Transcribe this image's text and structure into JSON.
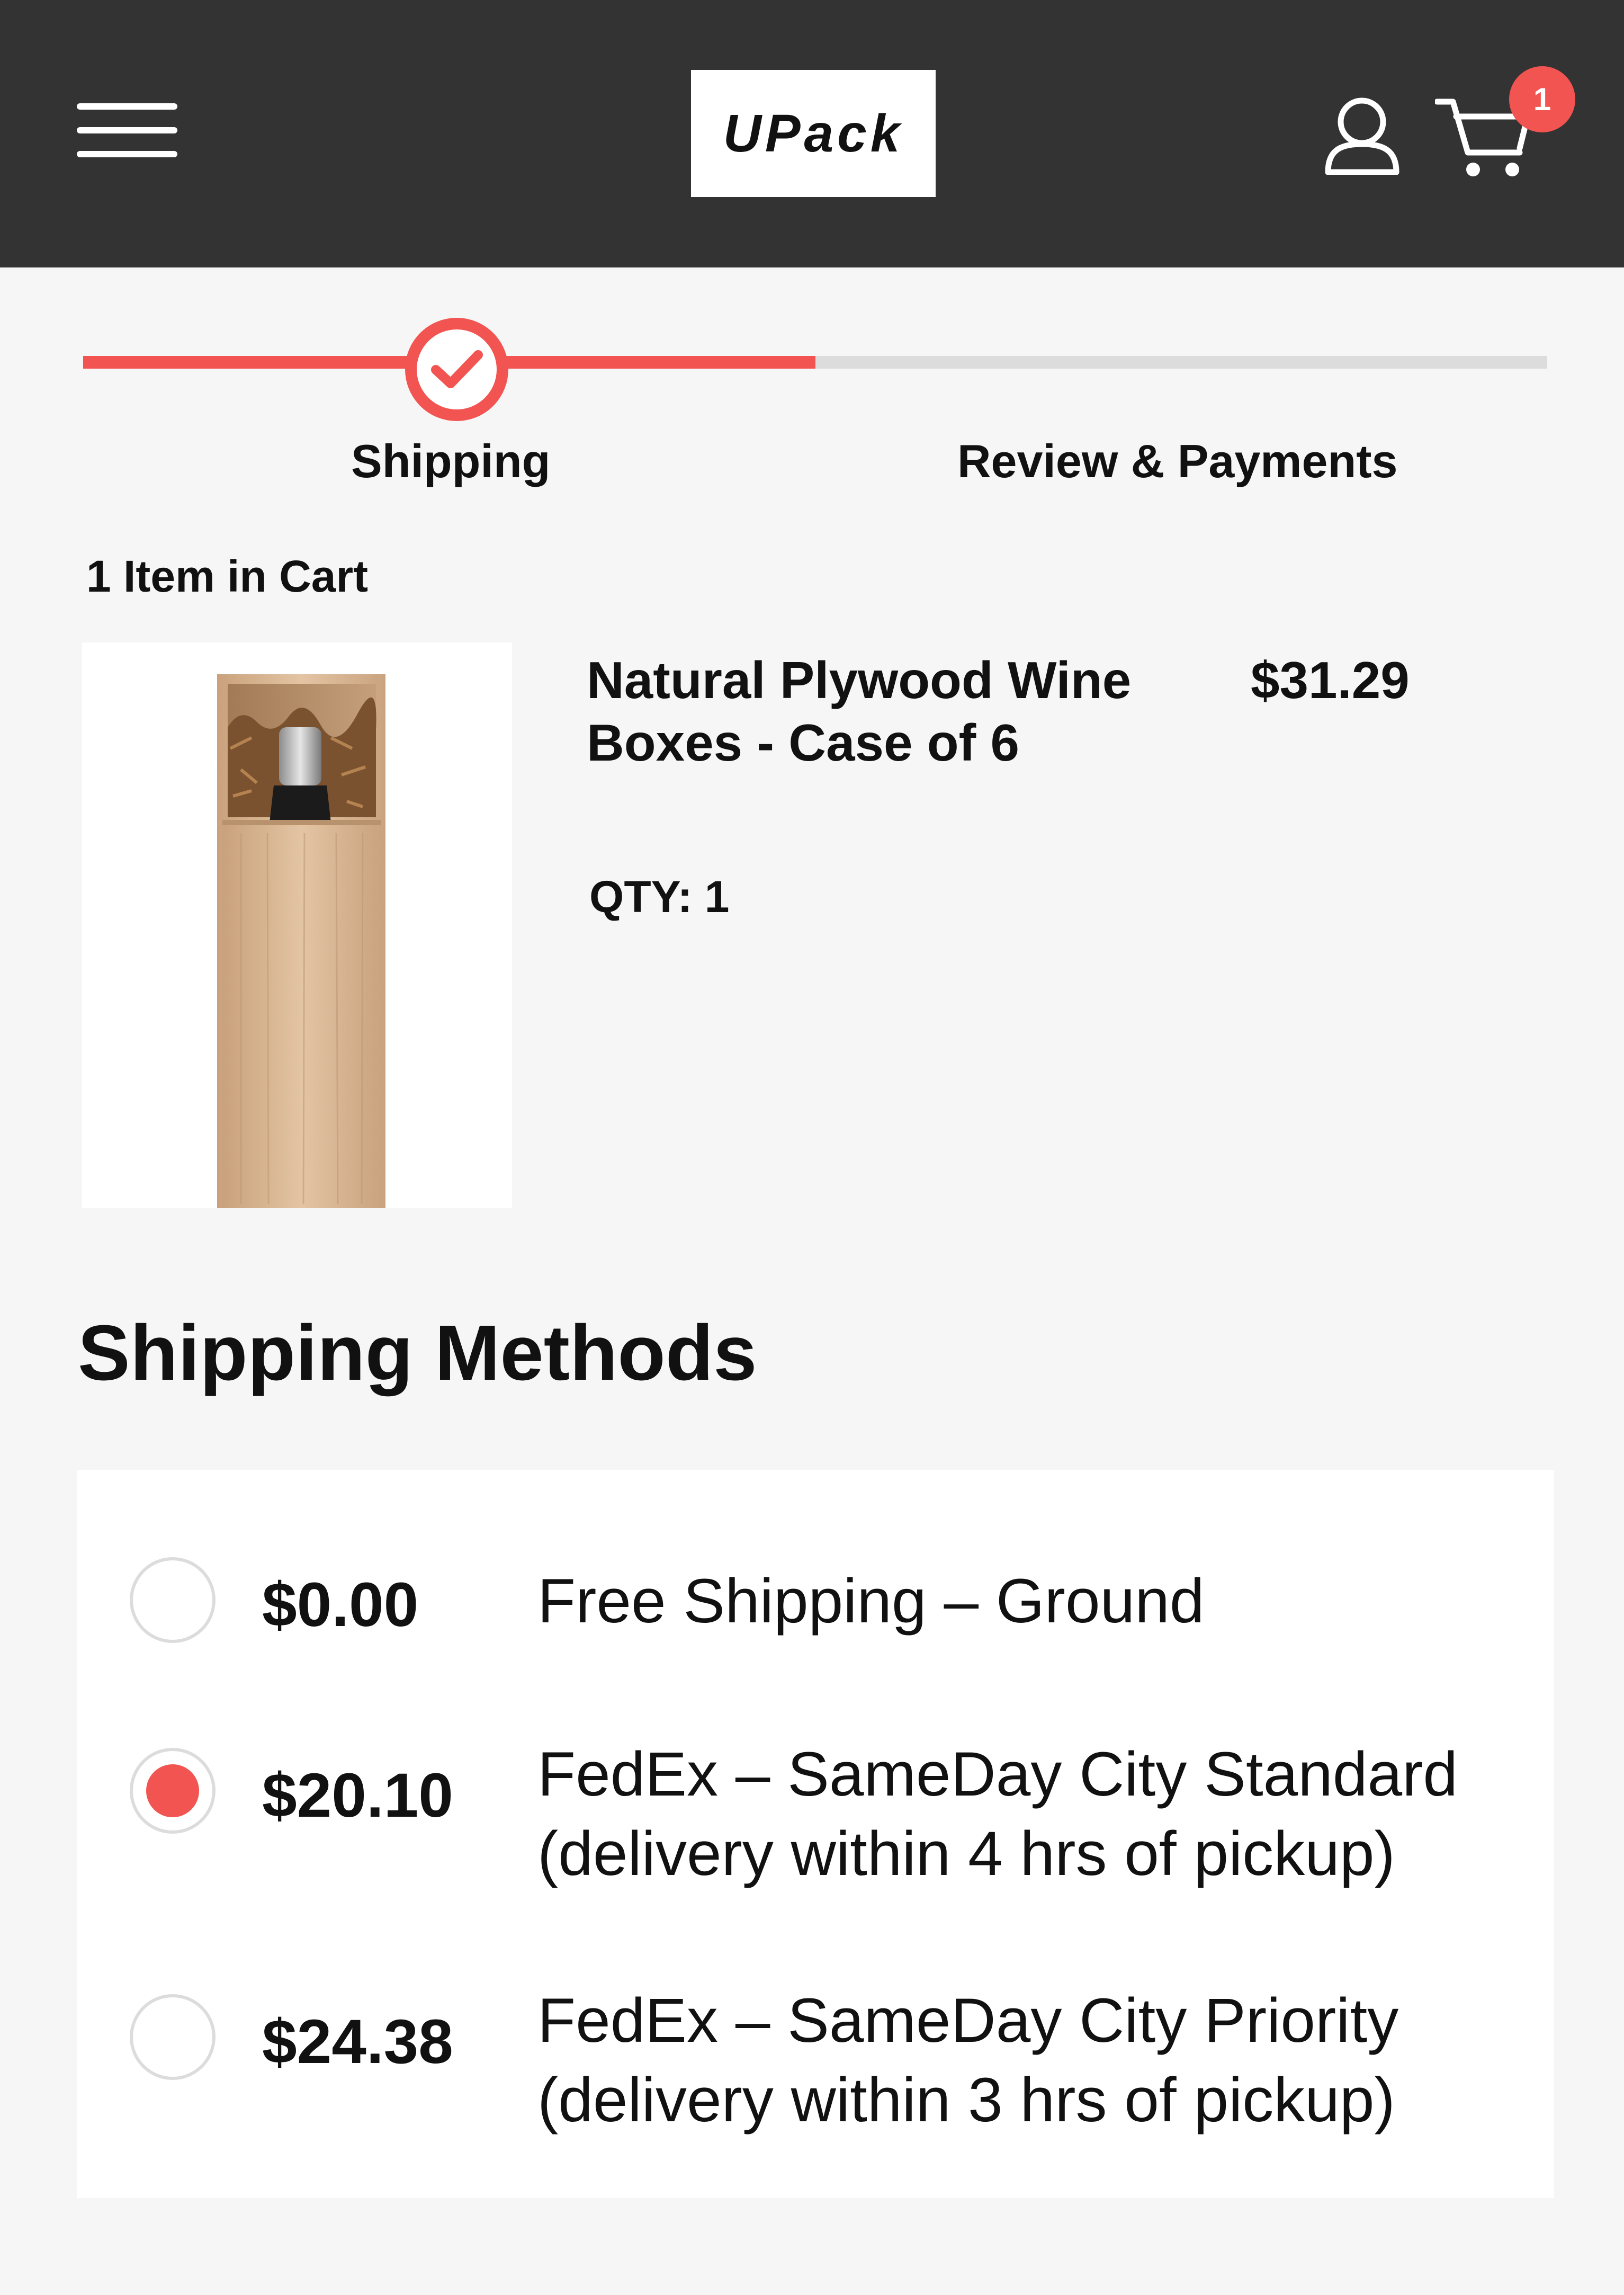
{
  "header": {
    "menu_icon": "hamburger-menu-icon",
    "logo_text": "UPack",
    "user_icon": "user-icon",
    "cart_icon": "shopping-cart-icon",
    "cart_badge": "1"
  },
  "checkout_progress": {
    "completed_fraction": 0.5,
    "steps": [
      {
        "label": "Shipping",
        "status": "complete"
      },
      {
        "label": "Review & Payments",
        "status": "pending"
      }
    ],
    "check_icon": "checkmark-icon"
  },
  "cart": {
    "count_label": "1 Item in Cart",
    "items": [
      {
        "name": "Natural Plywood Wine Boxes - Case of 6",
        "price": "$31.29",
        "qty_label": "QTY: 1",
        "image_icon": "wooden-wine-box-image"
      }
    ]
  },
  "shipping": {
    "title": "Shipping Methods",
    "methods": [
      {
        "price": "$0.00",
        "name": "Free Shipping – Ground",
        "selected": false
      },
      {
        "price": "$20.10",
        "name": "FedEx – SameDay City Standard (delivery within 4 hrs of pickup)",
        "selected": true
      },
      {
        "price": "$24.38",
        "name": "FedEx – SameDay City Priority (delivery within 3 hrs of pickup)",
        "selected": false
      }
    ]
  },
  "colors": {
    "header_bg": "#333333",
    "accent": "#f25451",
    "page_bg": "#f6f6f6",
    "track": "#dcdcdc"
  }
}
